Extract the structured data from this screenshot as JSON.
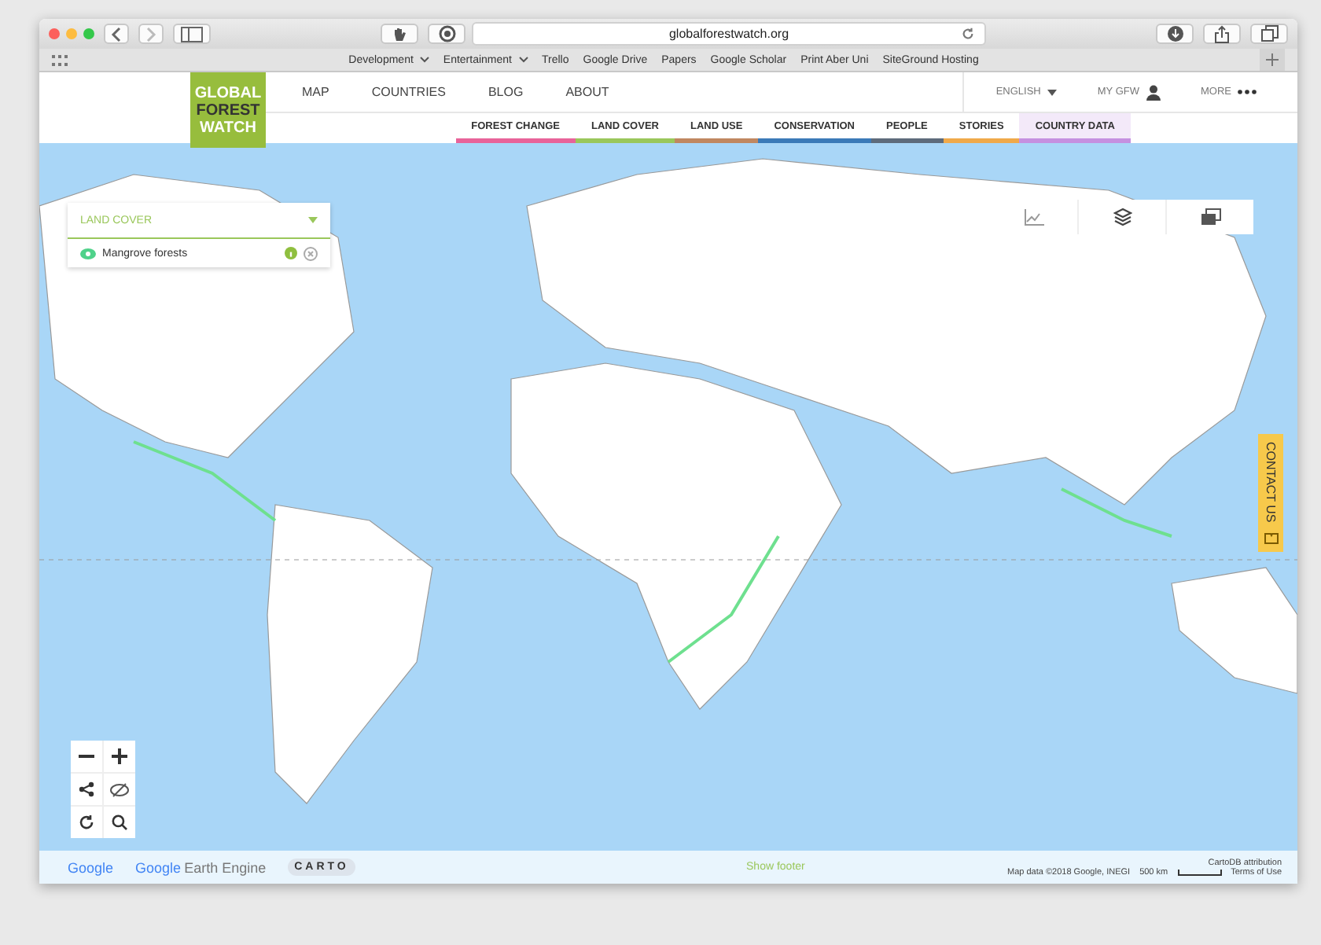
{
  "browser": {
    "url": "globalforestwatch.org",
    "bookmarks": [
      {
        "label": "Development",
        "menu": true
      },
      {
        "label": "Entertainment",
        "menu": true
      },
      {
        "label": "Trello",
        "menu": false
      },
      {
        "label": "Google Drive",
        "menu": false
      },
      {
        "label": "Papers",
        "menu": false
      },
      {
        "label": "Google Scholar",
        "menu": false
      },
      {
        "label": "Print Aber Uni",
        "menu": false
      },
      {
        "label": "SiteGround Hosting",
        "menu": false
      }
    ]
  },
  "logo": [
    "GLOBAL",
    "FOREST",
    "WATCH"
  ],
  "nav": [
    "MAP",
    "COUNTRIES",
    "BLOG",
    "ABOUT"
  ],
  "nav_right": {
    "language": "ENGLISH",
    "account": "MY GFW",
    "more": "MORE"
  },
  "subnav": [
    {
      "label": "FOREST CHANGE",
      "color": "#e8639a",
      "selected": false
    },
    {
      "label": "LAND COVER",
      "color": "#9ac75b",
      "selected": false
    },
    {
      "label": "LAND USE",
      "color": "#c08760",
      "selected": false
    },
    {
      "label": "CONSERVATION",
      "color": "#3b7ab8",
      "selected": false
    },
    {
      "label": "PEOPLE",
      "color": "#5e6b7b",
      "selected": false
    },
    {
      "label": "STORIES",
      "color": "#f0a94a",
      "selected": false
    },
    {
      "label": "COUNTRY DATA",
      "color": "#c590e0",
      "selected": true
    }
  ],
  "layer_panel": {
    "title": "LAND COVER",
    "layers": [
      {
        "name": "Mangrove forests",
        "visible": true
      }
    ]
  },
  "contact": "CONTACT US",
  "footer": {
    "partners": [
      "Google",
      "Google",
      "Earth Engine",
      "CARTO"
    ],
    "show_footer": "Show footer",
    "attribution": "CartoDB attribution",
    "map_data": "Map data ©2018 Google, INEGI",
    "scale": "500 km",
    "terms": "Terms of Use"
  }
}
